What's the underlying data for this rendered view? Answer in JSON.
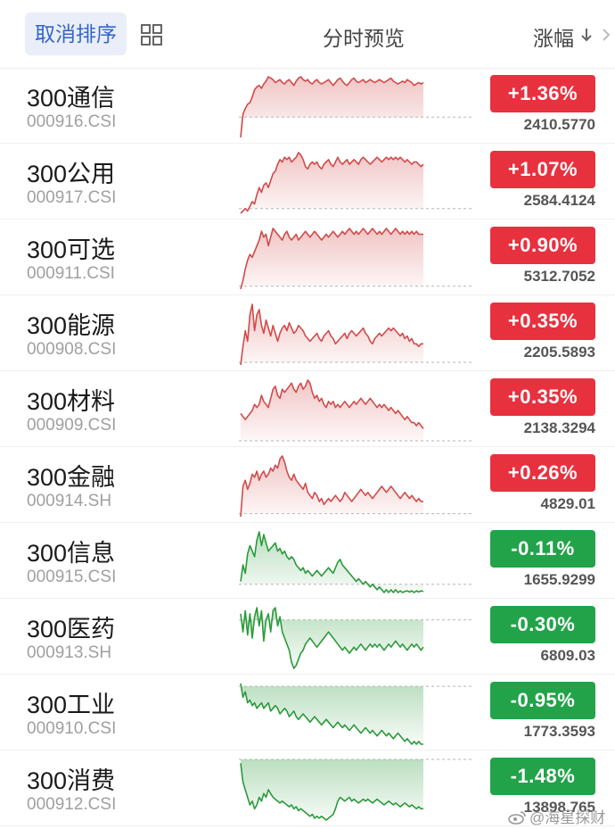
{
  "header": {
    "cancel_sort_label": "取消排序",
    "title": "分时预览",
    "sort_column_label": "涨幅"
  },
  "colors": {
    "up": "#e8313f",
    "down": "#22a34a",
    "up_line": "#d24a4a",
    "down_line": "#2a9a3a",
    "accent": "#3565c9"
  },
  "rows": [
    {
      "name": "300通信",
      "code": "000916.CSI",
      "change": "+1.36%",
      "price": "2410.5770",
      "direction": "up",
      "intraday": [
        -0.7,
        0.1,
        0.3,
        0.45,
        0.5,
        0.7,
        0.95,
        1.05,
        1.1,
        1.0,
        1.15,
        1.25,
        1.4,
        1.35,
        1.3,
        1.2,
        1.25,
        1.3,
        1.2,
        1.15,
        1.25,
        1.3,
        1.2,
        1.1,
        1.25,
        1.35,
        1.4,
        1.3,
        1.25,
        1.3,
        1.2,
        1.15,
        1.25,
        1.3,
        1.2,
        1.15,
        1.2,
        1.25,
        1.3,
        1.2,
        1.1,
        1.2,
        1.3,
        1.35,
        1.25,
        1.15,
        1.1,
        1.2,
        1.3,
        1.35,
        1.25,
        1.2,
        1.25,
        1.3,
        1.2,
        1.25,
        1.3,
        1.25,
        1.2,
        1.25,
        1.3,
        1.25,
        1.2,
        1.25,
        1.3,
        1.35,
        1.25,
        1.2,
        1.15,
        1.2,
        1.25,
        1.2,
        1.3,
        1.25,
        1.2,
        1.1,
        1.15,
        1.2,
        1.15,
        1.2
      ]
    },
    {
      "name": "300公用",
      "code": "000917.CSI",
      "change": "+1.07%",
      "price": "2584.4124",
      "direction": "up",
      "intraday": [
        -0.1,
        -0.05,
        0.0,
        -0.05,
        0.05,
        0.15,
        0.1,
        0.3,
        0.45,
        0.35,
        0.5,
        0.55,
        0.45,
        0.6,
        0.75,
        0.8,
        0.95,
        1.05,
        1.0,
        1.1,
        1.05,
        1.1,
        1.0,
        1.05,
        1.1,
        1.2,
        1.15,
        1.05,
        0.9,
        0.85,
        0.95,
        1.0,
        0.95,
        1.0,
        0.9,
        0.85,
        0.95,
        1.0,
        1.05,
        0.95,
        0.9,
        1.0,
        1.1,
        1.0,
        0.95,
        1.0,
        1.05,
        0.95,
        1.0,
        1.05,
        1.0,
        0.95,
        1.05,
        1.1,
        1.05,
        1.0,
        0.95,
        1.0,
        1.05,
        1.1,
        1.05,
        1.0,
        1.05,
        1.1,
        1.05,
        1.1,
        1.05,
        1.1,
        1.05,
        1.1,
        1.05,
        1.0,
        1.05,
        1.0,
        0.95,
        1.0,
        1.0,
        0.95,
        0.9,
        0.95
      ]
    },
    {
      "name": "300可选",
      "code": "000911.CSI",
      "change": "+0.90%",
      "price": "5312.7052",
      "direction": "up",
      "intraday": [
        -0.05,
        0.1,
        0.3,
        0.45,
        0.55,
        0.5,
        0.6,
        0.7,
        0.8,
        0.95,
        0.85,
        0.9,
        0.7,
        0.85,
        1.0,
        0.95,
        0.9,
        0.85,
        0.8,
        0.9,
        0.95,
        0.85,
        0.8,
        0.85,
        0.9,
        0.8,
        0.85,
        0.9,
        0.95,
        0.9,
        0.85,
        0.9,
        0.95,
        0.9,
        0.85,
        0.8,
        0.85,
        0.9,
        0.85,
        0.9,
        0.95,
        0.9,
        0.85,
        0.9,
        0.95,
        0.9,
        0.95,
        1.0,
        0.95,
        0.9,
        0.95,
        0.9,
        0.95,
        1.0,
        0.95,
        0.9,
        0.95,
        1.0,
        0.95,
        0.9,
        0.95,
        0.9,
        0.95,
        1.0,
        0.95,
        0.9,
        0.95,
        1.0,
        0.95,
        0.9,
        0.95,
        0.9,
        0.95,
        0.9,
        0.95,
        0.9,
        0.95,
        0.9,
        0.9,
        0.9
      ]
    },
    {
      "name": "300能源",
      "code": "000908.CSI",
      "change": "+0.35%",
      "price": "2205.5893",
      "direction": "up",
      "intraday": [
        -0.05,
        0.3,
        0.6,
        0.4,
        0.9,
        1.1,
        0.6,
        0.9,
        1.0,
        0.7,
        0.55,
        0.8,
        0.65,
        0.5,
        0.7,
        0.55,
        0.4,
        0.55,
        0.65,
        0.7,
        0.6,
        0.75,
        0.65,
        0.55,
        0.6,
        0.7,
        0.65,
        0.6,
        0.5,
        0.45,
        0.4,
        0.45,
        0.5,
        0.55,
        0.45,
        0.4,
        0.5,
        0.55,
        0.6,
        0.5,
        0.45,
        0.35,
        0.4,
        0.45,
        0.5,
        0.55,
        0.45,
        0.55,
        0.6,
        0.55,
        0.5,
        0.55,
        0.6,
        0.65,
        0.55,
        0.5,
        0.4,
        0.35,
        0.45,
        0.5,
        0.55,
        0.5,
        0.55,
        0.6,
        0.65,
        0.6,
        0.65,
        0.6,
        0.55,
        0.5,
        0.55,
        0.45,
        0.5,
        0.4,
        0.45,
        0.35,
        0.35,
        0.3,
        0.35,
        0.35
      ]
    },
    {
      "name": "300材料",
      "code": "000909.CSI",
      "change": "+0.35%",
      "price": "2138.3294",
      "direction": "up",
      "intraday": [
        0.45,
        0.4,
        0.35,
        0.4,
        0.45,
        0.5,
        0.6,
        0.55,
        0.6,
        0.75,
        0.65,
        0.6,
        0.55,
        0.7,
        0.85,
        0.9,
        0.75,
        0.7,
        0.85,
        0.8,
        0.85,
        0.9,
        0.95,
        0.85,
        0.8,
        0.9,
        0.95,
        0.85,
        0.9,
        1.0,
        0.95,
        0.8,
        0.7,
        0.75,
        0.65,
        0.7,
        0.6,
        0.55,
        0.65,
        0.6,
        0.65,
        0.55,
        0.6,
        0.55,
        0.6,
        0.65,
        0.6,
        0.55,
        0.6,
        0.65,
        0.6,
        0.65,
        0.7,
        0.65,
        0.6,
        0.65,
        0.7,
        0.65,
        0.6,
        0.55,
        0.6,
        0.55,
        0.6,
        0.55,
        0.5,
        0.55,
        0.5,
        0.45,
        0.5,
        0.45,
        0.4,
        0.35,
        0.4,
        0.35,
        0.3,
        0.3,
        0.25,
        0.3,
        0.25,
        0.2
      ]
    },
    {
      "name": "300金融",
      "code": "000914.SH",
      "change": "+0.26%",
      "price": "4829.01",
      "direction": "up",
      "intraday": [
        -0.05,
        0.45,
        0.55,
        0.4,
        0.5,
        0.65,
        0.6,
        0.7,
        0.55,
        0.65,
        0.7,
        0.6,
        0.65,
        0.75,
        0.7,
        0.8,
        0.75,
        0.9,
        0.95,
        0.85,
        0.7,
        0.6,
        0.55,
        0.65,
        0.55,
        0.5,
        0.45,
        0.4,
        0.5,
        0.35,
        0.3,
        0.25,
        0.35,
        0.3,
        0.2,
        0.25,
        0.15,
        0.2,
        0.25,
        0.2,
        0.25,
        0.3,
        0.25,
        0.2,
        0.25,
        0.35,
        0.3,
        0.25,
        0.2,
        0.25,
        0.3,
        0.35,
        0.4,
        0.35,
        0.3,
        0.35,
        0.3,
        0.25,
        0.3,
        0.35,
        0.4,
        0.45,
        0.4,
        0.35,
        0.4,
        0.45,
        0.4,
        0.35,
        0.3,
        0.25,
        0.3,
        0.35,
        0.3,
        0.25,
        0.3,
        0.25,
        0.2,
        0.25,
        0.2,
        0.2
      ]
    },
    {
      "name": "300信息",
      "code": "000915.CSI",
      "change": "-0.11%",
      "price": "1655.9299",
      "direction": "down",
      "intraday": [
        0.05,
        0.35,
        0.2,
        0.55,
        0.7,
        0.6,
        0.5,
        0.8,
        0.95,
        0.7,
        0.9,
        0.75,
        0.6,
        0.65,
        0.7,
        0.75,
        0.6,
        0.65,
        0.55,
        0.6,
        0.5,
        0.45,
        0.5,
        0.45,
        0.35,
        0.3,
        0.25,
        0.3,
        0.2,
        0.25,
        0.2,
        0.15,
        0.2,
        0.25,
        0.2,
        0.15,
        0.2,
        0.25,
        0.3,
        0.25,
        0.2,
        0.3,
        0.4,
        0.45,
        0.35,
        0.3,
        0.25,
        0.2,
        0.15,
        0.1,
        0.05,
        0.1,
        0.05,
        0.0,
        0.05,
        0.0,
        -0.05,
        0.0,
        -0.05,
        -0.1,
        -0.05,
        -0.1,
        -0.15,
        -0.1,
        -0.15,
        -0.1,
        -0.15,
        -0.1,
        -0.15,
        -0.12,
        -0.15,
        -0.13,
        -0.12,
        -0.14,
        -0.12,
        -0.15,
        -0.12,
        -0.14,
        -0.12,
        -0.13
      ]
    },
    {
      "name": "300医药",
      "code": "000913.SH",
      "change": "-0.30%",
      "price": "6809.03",
      "direction": "down",
      "intraday": [
        0.1,
        -0.2,
        0.15,
        -0.25,
        0.1,
        -0.3,
        0.05,
        0.2,
        -0.1,
        0.15,
        -0.35,
        0.0,
        0.1,
        -0.2,
        0.15,
        0.2,
        -0.1,
        0.05,
        -0.2,
        -0.3,
        -0.4,
        -0.5,
        -0.7,
        -0.8,
        -0.75,
        -0.65,
        -0.55,
        -0.5,
        -0.4,
        -0.35,
        -0.3,
        -0.35,
        -0.4,
        -0.45,
        -0.4,
        -0.35,
        -0.3,
        -0.25,
        -0.2,
        -0.25,
        -0.3,
        -0.35,
        -0.4,
        -0.45,
        -0.5,
        -0.45,
        -0.5,
        -0.55,
        -0.5,
        -0.45,
        -0.5,
        -0.45,
        -0.4,
        -0.45,
        -0.5,
        -0.45,
        -0.4,
        -0.45,
        -0.4,
        -0.45,
        -0.4,
        -0.45,
        -0.5,
        -0.45,
        -0.4,
        -0.45,
        -0.4,
        -0.35,
        -0.4,
        -0.45,
        -0.4,
        -0.45,
        -0.5,
        -0.45,
        -0.4,
        -0.45,
        -0.4,
        -0.45,
        -0.5,
        -0.45
      ]
    },
    {
      "name": "300工业",
      "code": "000910.CSI",
      "change": "-0.95%",
      "price": "1773.3593",
      "direction": "down",
      "intraday": [
        0.05,
        -0.2,
        -0.1,
        -0.3,
        -0.25,
        -0.35,
        -0.3,
        -0.4,
        -0.35,
        -0.3,
        -0.4,
        -0.35,
        -0.3,
        -0.45,
        -0.4,
        -0.35,
        -0.4,
        -0.5,
        -0.45,
        -0.4,
        -0.45,
        -0.55,
        -0.5,
        -0.45,
        -0.55,
        -0.6,
        -0.55,
        -0.5,
        -0.55,
        -0.6,
        -0.65,
        -0.6,
        -0.55,
        -0.6,
        -0.65,
        -0.7,
        -0.65,
        -0.6,
        -0.65,
        -0.7,
        -0.75,
        -0.7,
        -0.65,
        -0.7,
        -0.75,
        -0.7,
        -0.75,
        -0.8,
        -0.75,
        -0.7,
        -0.75,
        -0.8,
        -0.85,
        -0.8,
        -0.75,
        -0.8,
        -0.85,
        -0.8,
        -0.85,
        -0.9,
        -0.85,
        -0.8,
        -0.85,
        -0.9,
        -0.85,
        -0.9,
        -0.95,
        -0.9,
        -0.85,
        -0.9,
        -0.95,
        -1.0,
        -0.95,
        -1.0,
        -1.05,
        -1.0,
        -1.05,
        -1.0,
        -1.05,
        -1.05
      ]
    },
    {
      "name": "300消费",
      "code": "000912.CSI",
      "change": "-1.48%",
      "price": "13898.765",
      "direction": "down",
      "intraday": [
        -0.1,
        -0.6,
        -0.8,
        -1.0,
        -1.2,
        -1.1,
        -1.3,
        -1.2,
        -1.0,
        -1.1,
        -0.9,
        -1.0,
        -0.8,
        -0.9,
        -1.0,
        -1.05,
        -1.1,
        -1.15,
        -1.1,
        -1.15,
        -1.2,
        -1.25,
        -1.2,
        -1.3,
        -1.25,
        -1.35,
        -1.3,
        -1.35,
        -1.4,
        -1.45,
        -1.5,
        -1.45,
        -1.55,
        -1.5,
        -1.55,
        -1.5,
        -1.55,
        -1.6,
        -1.55,
        -1.5,
        -1.45,
        -1.3,
        -1.1,
        -1.0,
        -1.05,
        -1.1,
        -1.05,
        -1.0,
        -1.1,
        -1.05,
        -1.1,
        -1.15,
        -1.1,
        -1.05,
        -1.1,
        -1.05,
        -1.1,
        -1.15,
        -1.1,
        -1.05,
        -1.1,
        -1.15,
        -1.2,
        -1.15,
        -1.1,
        -1.15,
        -1.2,
        -1.15,
        -1.2,
        -1.25,
        -1.2,
        -1.15,
        -1.2,
        -1.25,
        -1.2,
        -1.25,
        -1.3,
        -1.25,
        -1.3,
        -1.3
      ]
    }
  ],
  "watermark": {
    "text": "@海星探财"
  }
}
